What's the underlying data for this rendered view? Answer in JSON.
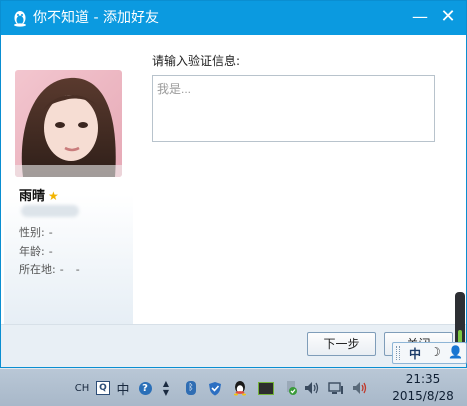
{
  "window": {
    "title": "你不知道 - 添加好友",
    "minimize_glyph": "—",
    "close_glyph": "✕"
  },
  "profile": {
    "nickname": "雨晴",
    "star_icon": "star-icon",
    "gender_label": "性别:",
    "gender_value": "-",
    "age_label": "年龄:",
    "age_value": "-",
    "location_label": "所在地:",
    "location_value_1": "-",
    "location_value_2": "-"
  },
  "verify": {
    "label": "请输入验证信息:",
    "placeholder": "我是..."
  },
  "buttons": {
    "next": "下一步",
    "close": "关闭"
  },
  "ime": {
    "mode": "中",
    "moon": "☽",
    "user": "👤"
  },
  "taskbar": {
    "lang": "CH",
    "zh": "中",
    "help": "?",
    "qq_box": "Q",
    "bt": "ᛒ",
    "clock_time": "21:35",
    "clock_date": "2015/8/28"
  },
  "colors": {
    "titlebar": "#0b9ae0",
    "footer": "#e8eff5",
    "taskbar": "#b3c2d2"
  }
}
